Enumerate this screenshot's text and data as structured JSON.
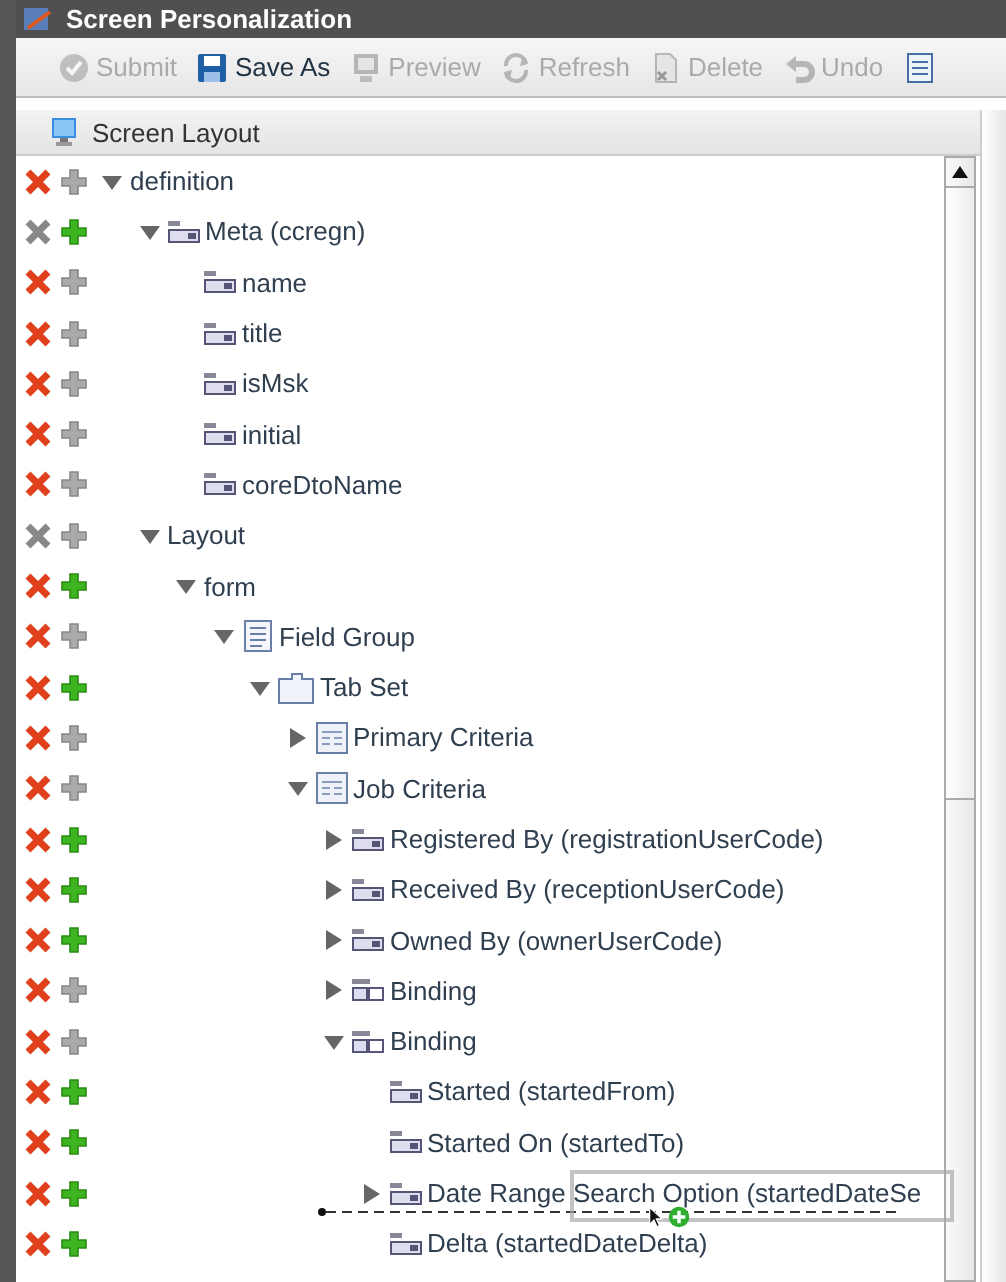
{
  "window": {
    "title": "Screen Personalization"
  },
  "toolbar": {
    "buttons": [
      {
        "label": "Submit",
        "kind": "submit",
        "disabled": true
      },
      {
        "label": "Save As",
        "kind": "save",
        "disabled": false
      },
      {
        "label": "Preview",
        "kind": "preview",
        "disabled": true
      },
      {
        "label": "Refresh",
        "kind": "refresh",
        "disabled": true
      },
      {
        "label": "Delete",
        "kind": "delete",
        "disabled": true
      },
      {
        "label": "Undo",
        "kind": "undo",
        "disabled": true
      },
      {
        "kind": "list",
        "disabled": false
      }
    ]
  },
  "panel": {
    "title": "Screen Layout"
  },
  "tree": [
    {
      "label": "definition",
      "can_delete": true,
      "can_add": false,
      "expanded": true,
      "children": [
        {
          "label": "Meta (ccregn)",
          "kind": "field",
          "can_delete": false,
          "can_add": true,
          "expanded": true,
          "children": [
            {
              "label": "name",
              "kind": "field",
              "can_delete": true,
              "can_add": false
            },
            {
              "label": "title",
              "kind": "field",
              "can_delete": true,
              "can_add": false
            },
            {
              "label": "isMsk",
              "kind": "field",
              "can_delete": true,
              "can_add": false
            },
            {
              "label": "initial",
              "kind": "field",
              "can_delete": true,
              "can_add": false
            },
            {
              "label": "coreDtoName",
              "kind": "field",
              "can_delete": true,
              "can_add": false
            }
          ]
        },
        {
          "label": "Layout",
          "can_delete": false,
          "can_add": false,
          "expanded": true,
          "children": [
            {
              "label": "form",
              "can_delete": true,
              "can_add": true,
              "expanded": true,
              "children": [
                {
                  "label": "Field Group",
                  "kind": "fieldgroup",
                  "can_delete": true,
                  "can_add": false,
                  "expanded": true,
                  "children": [
                    {
                      "label": "Tab Set",
                      "kind": "tabset",
                      "can_delete": true,
                      "can_add": true,
                      "expanded": true,
                      "children": [
                        {
                          "label": "Primary Criteria",
                          "kind": "tab",
                          "can_delete": true,
                          "can_add": false,
                          "expanded": false
                        },
                        {
                          "label": "Job Criteria",
                          "kind": "tab",
                          "can_delete": true,
                          "can_add": false,
                          "expanded": true,
                          "children": [
                            {
                              "label": "Registered By (registrationUserCode)",
                              "kind": "field",
                              "can_delete": true,
                              "can_add": true,
                              "expanded": false
                            },
                            {
                              "label": "Received By (receptionUserCode)",
                              "kind": "field",
                              "can_delete": true,
                              "can_add": true,
                              "expanded": false
                            },
                            {
                              "label": "Owned By (ownerUserCode)",
                              "kind": "field",
                              "can_delete": true,
                              "can_add": true,
                              "expanded": false
                            },
                            {
                              "label": "Binding",
                              "kind": "binding",
                              "can_delete": true,
                              "can_add": false,
                              "expanded": false
                            },
                            {
                              "label": "Binding",
                              "kind": "binding",
                              "can_delete": true,
                              "can_add": false,
                              "expanded": true,
                              "children": [
                                {
                                  "label": "Started (startedFrom)",
                                  "kind": "field",
                                  "can_delete": true,
                                  "can_add": true
                                },
                                {
                                  "label": "Started On (startedTo)",
                                  "kind": "field",
                                  "can_delete": true,
                                  "can_add": true
                                },
                                {
                                  "label": "Date Range Search Option (startedDateSe",
                                  "kind": "field",
                                  "can_delete": true,
                                  "can_add": true,
                                  "expanded": false
                                },
                                {
                                  "label": "Delta (startedDateDelta)",
                                  "kind": "field",
                                  "can_delete": true,
                                  "can_add": true
                                }
                              ]
                            }
                          ]
                        }
                      ]
                    }
                  ]
                }
              ]
            }
          ]
        }
      ]
    }
  ],
  "drag": {
    "kind": "drop-indicator"
  }
}
